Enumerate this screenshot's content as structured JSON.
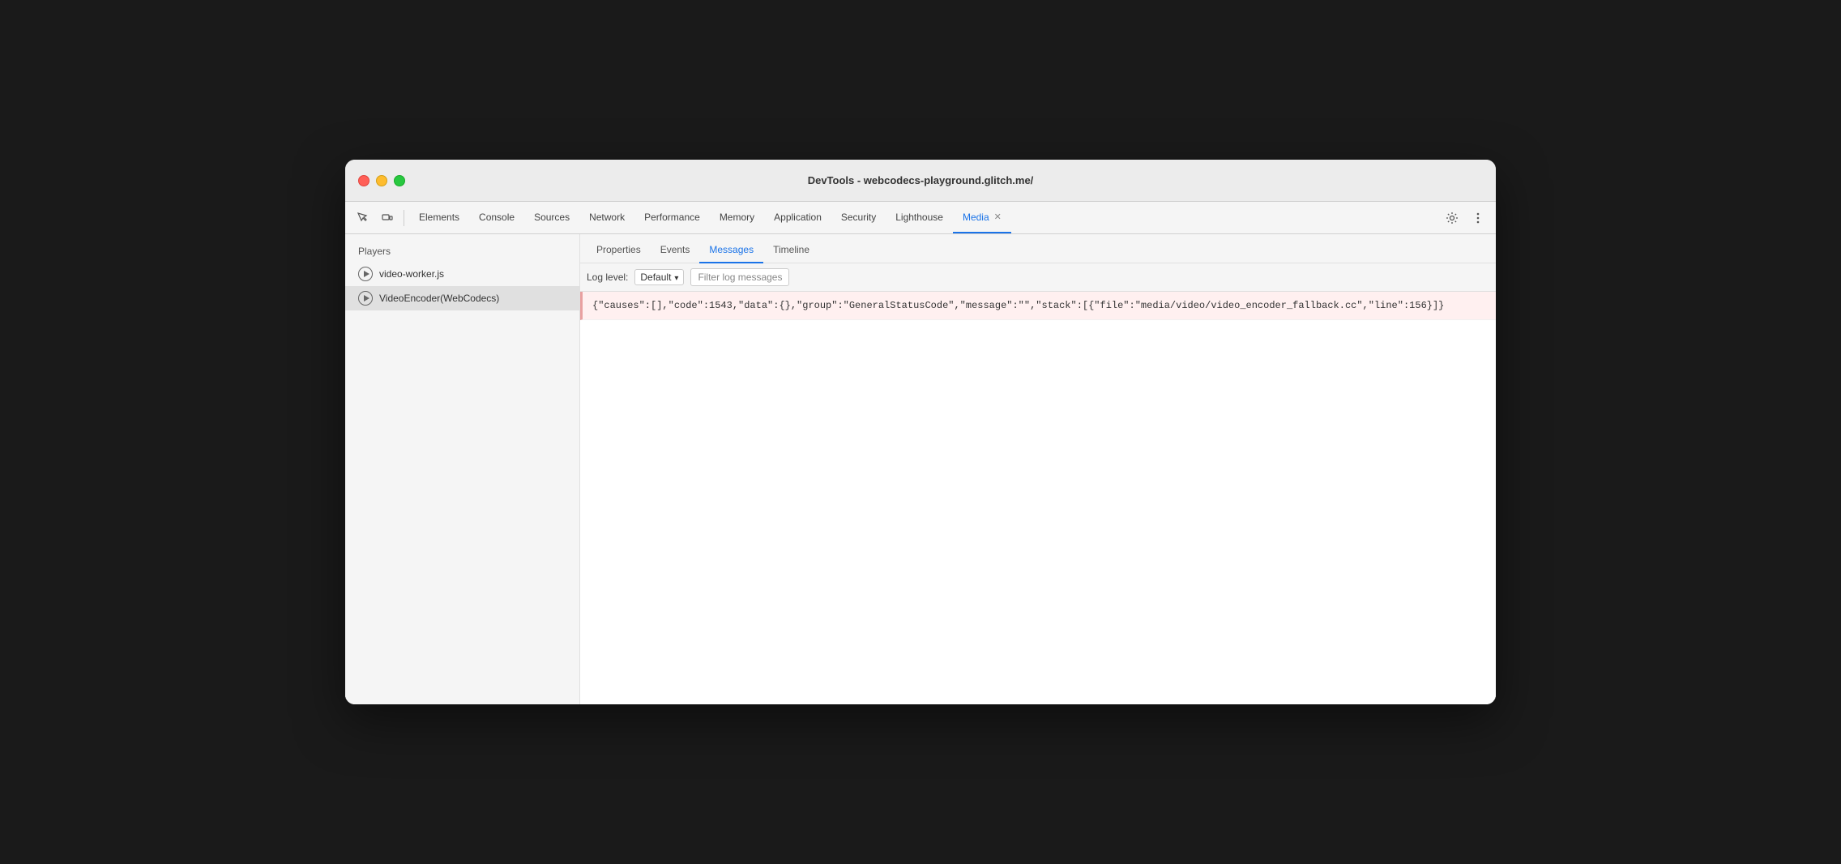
{
  "window": {
    "title": "DevTools - webcodecs-playground.glitch.me/"
  },
  "toolbar": {
    "tabs": [
      {
        "id": "elements",
        "label": "Elements",
        "active": false
      },
      {
        "id": "console",
        "label": "Console",
        "active": false
      },
      {
        "id": "sources",
        "label": "Sources",
        "active": false
      },
      {
        "id": "network",
        "label": "Network",
        "active": false
      },
      {
        "id": "performance",
        "label": "Performance",
        "active": false
      },
      {
        "id": "memory",
        "label": "Memory",
        "active": false
      },
      {
        "id": "application",
        "label": "Application",
        "active": false
      },
      {
        "id": "security",
        "label": "Security",
        "active": false
      },
      {
        "id": "lighthouse",
        "label": "Lighthouse",
        "active": false
      },
      {
        "id": "media",
        "label": "Media",
        "active": true,
        "closeable": true
      }
    ]
  },
  "sidebar": {
    "title": "Players",
    "players": [
      {
        "id": "video-worker",
        "label": "video-worker.js",
        "selected": false
      },
      {
        "id": "video-encoder",
        "label": "VideoEncoder(WebCodecs)",
        "selected": true
      }
    ]
  },
  "panel": {
    "tabs": [
      {
        "id": "properties",
        "label": "Properties",
        "active": false
      },
      {
        "id": "events",
        "label": "Events",
        "active": false
      },
      {
        "id": "messages",
        "label": "Messages",
        "active": true
      },
      {
        "id": "timeline",
        "label": "Timeline",
        "active": false
      }
    ],
    "log_toolbar": {
      "log_level_label": "Log level:",
      "log_level_value": "Default",
      "filter_placeholder": "Filter log messages"
    },
    "messages": [
      {
        "id": "msg1",
        "type": "error",
        "text": "{\"causes\":[],\"code\":1543,\"data\":{},\"group\":\"GeneralStatusCode\",\"message\":\"\",\"stack\":[{\"file\":\"media/video/video_encoder_fallback.cc\",\"line\":156}]}"
      }
    ]
  }
}
